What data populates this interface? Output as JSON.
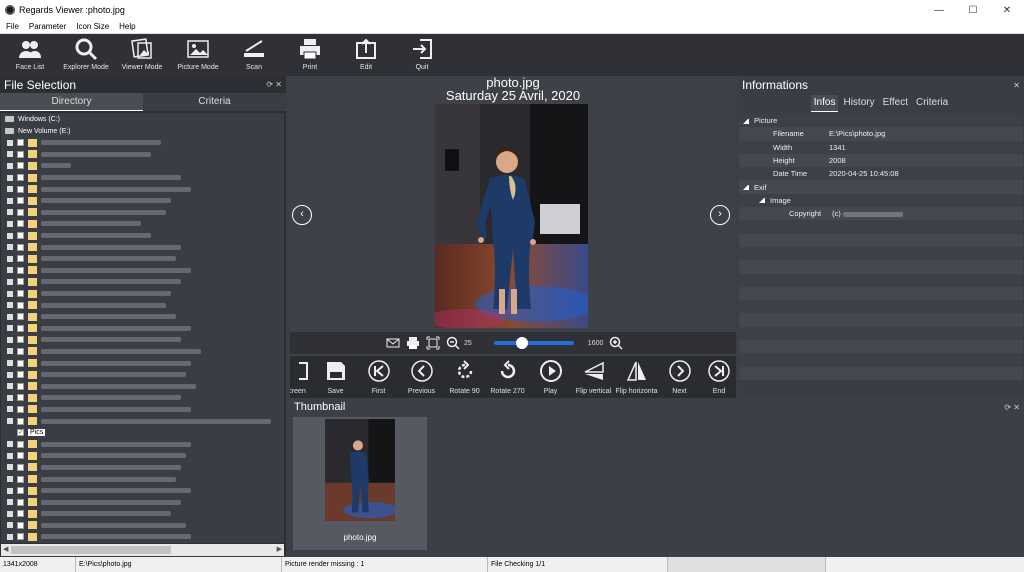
{
  "window": {
    "title": "Regards Viewer :photo.jpg",
    "minimize": "—",
    "maximize": "☐",
    "close": "✕"
  },
  "menu": [
    "File",
    "Parameter",
    "Icon Size",
    "Help"
  ],
  "toolbar": [
    {
      "label": "Face List",
      "icon": "users-icon"
    },
    {
      "label": "Explorer Mode",
      "icon": "search-icon"
    },
    {
      "label": "Viewer Mode",
      "icon": "viewer-icon"
    },
    {
      "label": "Picture Mode",
      "icon": "picture-icon"
    },
    {
      "label": "Scan",
      "icon": "scan-icon"
    },
    {
      "label": "Print",
      "icon": "print-icon"
    },
    {
      "label": "Edit",
      "icon": "edit-icon"
    },
    {
      "label": "Quit",
      "icon": "quit-icon"
    }
  ],
  "file_selection": {
    "title": "File Selection",
    "controls": "⟳ ✕",
    "tabs": [
      "Directory",
      "Criteria"
    ],
    "drives": [
      "Windows (C:)",
      "New Volume (E:)"
    ],
    "selected_folder": "Pics"
  },
  "viewer": {
    "filename": "photo.jpg",
    "date": "Saturday 25 Avril, 2020",
    "zoom_min": "25",
    "zoom_max": "1600",
    "zoom_level": 0.35
  },
  "viewer_toolbar": [
    {
      "label": "creen",
      "icon": "fullscreen-icon"
    },
    {
      "label": "Save",
      "icon": "save-icon"
    },
    {
      "label": "First",
      "icon": "first-icon"
    },
    {
      "label": "Previous",
      "icon": "previous-icon"
    },
    {
      "label": "Rotate 90",
      "icon": "rotate-90-icon"
    },
    {
      "label": "Rotate 270",
      "icon": "rotate-270-icon"
    },
    {
      "label": "Play",
      "icon": "play-icon"
    },
    {
      "label": "Flip vertical",
      "icon": "flip-vertical-icon"
    },
    {
      "label": "Flip horizonta",
      "icon": "flip-horizontal-icon"
    },
    {
      "label": "Next",
      "icon": "next-icon"
    },
    {
      "label": "End",
      "icon": "end-icon"
    }
  ],
  "informations": {
    "title": "Informations",
    "close": "✕",
    "tabs": [
      "Infos",
      "History",
      "Effect",
      "Criteria"
    ],
    "picture_section": "Picture",
    "rows": [
      {
        "key": "Filename",
        "value": "E:\\Pics\\photo.jpg"
      },
      {
        "key": "Width",
        "value": "1341"
      },
      {
        "key": "Height",
        "value": "2008"
      },
      {
        "key": "Date Time",
        "value": "2020-04-25 10:45:08"
      }
    ],
    "exif_section": "Exif",
    "image_section": "Image",
    "copyright_key": "Copyright",
    "copyright_value": "(c)"
  },
  "thumbnail": {
    "title": "Thumbnail",
    "controls": "⟳ ✕",
    "items": [
      {
        "name": "photo.jpg"
      }
    ]
  },
  "status": {
    "dimensions": "1341x2008",
    "path": "E:\\Pics\\photo.jpg",
    "render": "Picture render missing : 1",
    "checking": "File Checking 1/1"
  }
}
